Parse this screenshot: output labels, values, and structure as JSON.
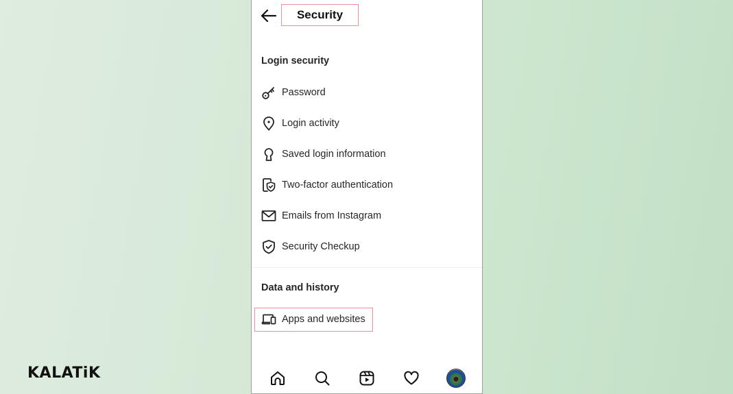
{
  "header": {
    "title": "Security",
    "back_icon": "arrow-left-icon"
  },
  "sections": [
    {
      "title": "Login security",
      "items": [
        {
          "label": "Password",
          "icon": "key-icon"
        },
        {
          "label": "Login activity",
          "icon": "location-pin-icon"
        },
        {
          "label": "Saved login information",
          "icon": "keyhole-icon"
        },
        {
          "label": "Two-factor authentication",
          "icon": "device-shield-icon"
        },
        {
          "label": "Emails from Instagram",
          "icon": "envelope-icon"
        },
        {
          "label": "Security Checkup",
          "icon": "shield-check-icon"
        }
      ]
    },
    {
      "title": "Data and history",
      "items": [
        {
          "label": "Apps and websites",
          "icon": "laptop-phone-icon"
        }
      ]
    }
  ],
  "bottom_nav": [
    {
      "name": "home",
      "icon": "home-icon"
    },
    {
      "name": "search",
      "icon": "search-icon"
    },
    {
      "name": "reels",
      "icon": "reels-icon"
    },
    {
      "name": "activity",
      "icon": "heart-icon"
    },
    {
      "name": "profile",
      "icon": "avatar"
    }
  ],
  "watermark": {
    "logo_text": "KALATiK"
  },
  "colors": {
    "highlight_border": "#ee8d94",
    "text": "#262626",
    "background_start": "#dfece0",
    "background_end": "#c2e0c6"
  }
}
